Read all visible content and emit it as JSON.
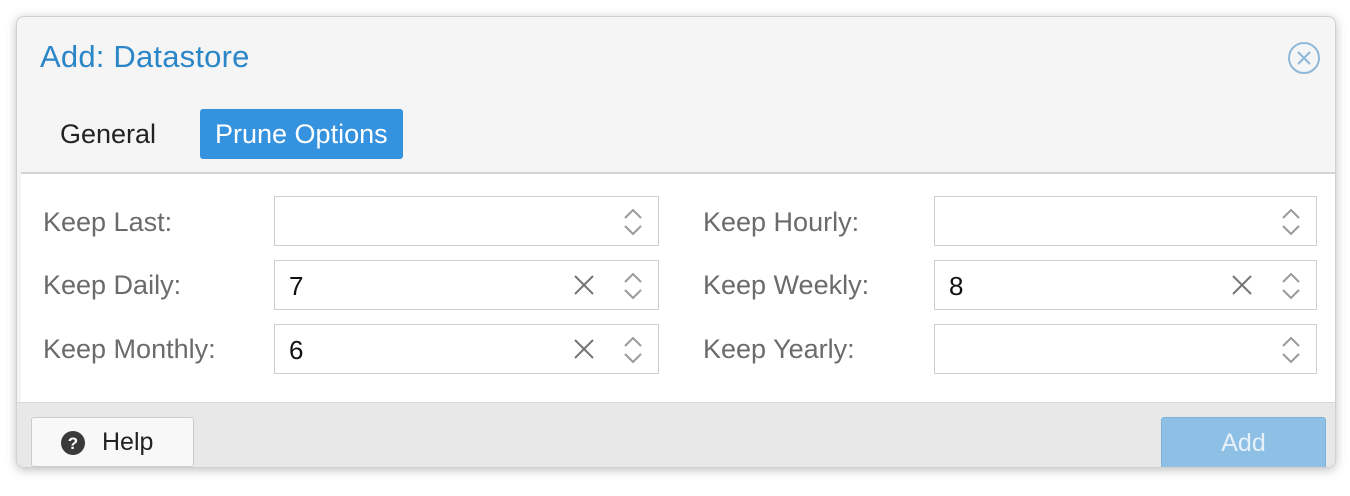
{
  "dialog": {
    "title": "Add: Datastore",
    "accent_color": "#2b86c8",
    "close_icon": "close-circle-icon"
  },
  "tabs": [
    {
      "label": "General",
      "active": false
    },
    {
      "label": "Prune Options",
      "active": true
    }
  ],
  "fields": {
    "keep_last": {
      "label": "Keep Last:",
      "value": ""
    },
    "keep_hourly": {
      "label": "Keep Hourly:",
      "value": ""
    },
    "keep_daily": {
      "label": "Keep Daily:",
      "value": "7"
    },
    "keep_weekly": {
      "label": "Keep Weekly:",
      "value": "8"
    },
    "keep_monthly": {
      "label": "Keep Monthly:",
      "value": "6"
    },
    "keep_yearly": {
      "label": "Keep Yearly:",
      "value": ""
    }
  },
  "footer": {
    "help_label": "Help",
    "help_icon": "question-circle-icon",
    "add_label": "Add",
    "add_disabled": true,
    "add_color": "#8ebfe5"
  }
}
